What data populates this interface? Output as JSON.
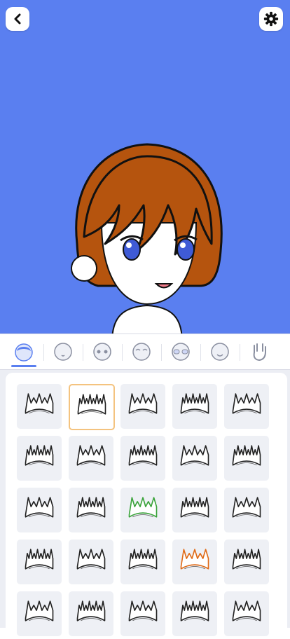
{
  "header": {
    "back_icon": "chevron-left-icon",
    "settings_icon": "gear-icon",
    "background_color": "#5a7ff0"
  },
  "tabs": [
    {
      "name": "hair",
      "icon": "hair-icon",
      "active": true
    },
    {
      "name": "face-shape",
      "icon": "face-icon"
    },
    {
      "name": "eyes",
      "icon": "eyes-icon"
    },
    {
      "name": "eyebrows",
      "icon": "eyebrows-icon"
    },
    {
      "name": "glasses",
      "icon": "glasses-icon"
    },
    {
      "name": "mouth",
      "icon": "mouth-icon"
    },
    {
      "name": "pose",
      "icon": "hand-icon"
    }
  ],
  "hair_styles": {
    "selected_index": 1,
    "count": 25
  },
  "colors": {
    "accent": "#5a7ff0",
    "hair": "#b5540e",
    "selection_border": "#f4c37f"
  }
}
